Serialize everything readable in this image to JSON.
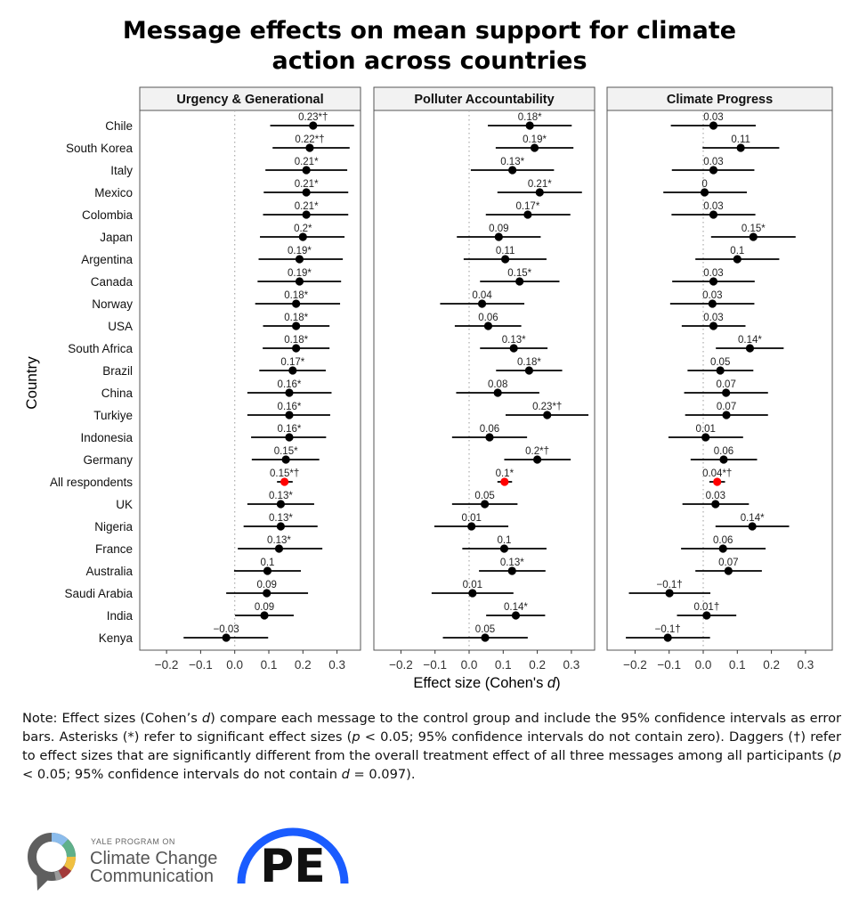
{
  "title_lines": [
    "Message effects on mean support for climate",
    "action across countries"
  ],
  "chart_data": {
    "type": "forest",
    "ylabel": "Country",
    "xlabel_main": "Effect size (Cohen's ",
    "xlabel_italic": "d",
    "xlabel_close": ")",
    "xlim": [
      -0.28,
      0.37
    ],
    "xticks": [
      -0.2,
      -0.1,
      0.0,
      0.1,
      0.2,
      0.3
    ],
    "xtick_labels": [
      "−0.2",
      "−0.1",
      "0.0",
      "0.1",
      "0.2",
      "0.3"
    ],
    "reference_line": 0,
    "highlight_color": "#ff0000",
    "point_color": "#000000",
    "countries": [
      "Chile",
      "South Korea",
      "Italy",
      "Mexico",
      "Colombia",
      "Japan",
      "Argentina",
      "Canada",
      "Norway",
      "USA",
      "South Africa",
      "Brazil",
      "China",
      "Turkiye",
      "Indonesia",
      "Germany",
      "All respondents",
      "UK",
      "Nigeria",
      "France",
      "Australia",
      "Saudi Arabia",
      "India",
      "Kenya"
    ],
    "highlight_row": "All respondents",
    "panels": [
      {
        "title": "Urgency & Generational",
        "points": [
          {
            "label": "0.23*†",
            "d": 0.23,
            "ci": [
              0.104,
              0.35
            ]
          },
          {
            "label": "0.22*†",
            "d": 0.22,
            "ci": [
              0.111,
              0.337
            ]
          },
          {
            "label": "0.21*",
            "d": 0.21,
            "ci": [
              0.09,
              0.33
            ]
          },
          {
            "label": "0.21*",
            "d": 0.21,
            "ci": [
              0.085,
              0.333
            ]
          },
          {
            "label": "0.21*",
            "d": 0.21,
            "ci": [
              0.083,
              0.333
            ]
          },
          {
            "label": "0.2*",
            "d": 0.2,
            "ci": [
              0.074,
              0.322
            ]
          },
          {
            "label": "0.19*",
            "d": 0.19,
            "ci": [
              0.07,
              0.317
            ]
          },
          {
            "label": "0.19*",
            "d": 0.19,
            "ci": [
              0.067,
              0.312
            ]
          },
          {
            "label": "0.18*",
            "d": 0.18,
            "ci": [
              0.06,
              0.309
            ]
          },
          {
            "label": "0.18*",
            "d": 0.18,
            "ci": [
              0.083,
              0.278
            ]
          },
          {
            "label": "0.18*",
            "d": 0.18,
            "ci": [
              0.082,
              0.278
            ]
          },
          {
            "label": "0.17*",
            "d": 0.17,
            "ci": [
              0.072,
              0.267
            ]
          },
          {
            "label": "0.16*",
            "d": 0.16,
            "ci": [
              0.037,
              0.284
            ]
          },
          {
            "label": "0.16*",
            "d": 0.16,
            "ci": [
              0.037,
              0.28
            ]
          },
          {
            "label": "0.16*",
            "d": 0.16,
            "ci": [
              0.048,
              0.268
            ]
          },
          {
            "label": "0.15*",
            "d": 0.15,
            "ci": [
              0.05,
              0.248
            ]
          },
          {
            "label": "0.15*†",
            "d": 0.146,
            "ci": [
              0.124,
              0.17
            ]
          },
          {
            "label": "0.13*",
            "d": 0.135,
            "ci": [
              0.037,
              0.233
            ]
          },
          {
            "label": "0.13*",
            "d": 0.135,
            "ci": [
              0.026,
              0.243
            ]
          },
          {
            "label": "0.13*",
            "d": 0.13,
            "ci": [
              0.009,
              0.257
            ]
          },
          {
            "label": "0.1",
            "d": 0.096,
            "ci": [
              -0.002,
              0.194
            ]
          },
          {
            "label": "0.09",
            "d": 0.094,
            "ci": [
              -0.025,
              0.215
            ]
          },
          {
            "label": "0.09",
            "d": 0.087,
            "ci": [
              0.001,
              0.173
            ]
          },
          {
            "label": "−0.03",
            "d": -0.025,
            "ci": [
              -0.15,
              0.098
            ]
          }
        ]
      },
      {
        "title": "Polluter Accountability",
        "points": [
          {
            "label": "0.18*",
            "d": 0.178,
            "ci": [
              0.055,
              0.301
            ]
          },
          {
            "label": "0.19*",
            "d": 0.192,
            "ci": [
              0.078,
              0.306
            ]
          },
          {
            "label": "0.13*",
            "d": 0.127,
            "ci": [
              0.005,
              0.249
            ]
          },
          {
            "label": "0.21*",
            "d": 0.207,
            "ci": [
              0.083,
              0.331
            ]
          },
          {
            "label": "0.17*",
            "d": 0.172,
            "ci": [
              0.049,
              0.297
            ]
          },
          {
            "label": "0.09",
            "d": 0.087,
            "ci": [
              -0.036,
              0.21
            ]
          },
          {
            "label": "0.11",
            "d": 0.106,
            "ci": [
              -0.016,
              0.227
            ]
          },
          {
            "label": "0.15*",
            "d": 0.148,
            "ci": [
              0.032,
              0.265
            ]
          },
          {
            "label": "0.04",
            "d": 0.038,
            "ci": [
              -0.085,
              0.162
            ]
          },
          {
            "label": "0.06",
            "d": 0.056,
            "ci": [
              -0.042,
              0.153
            ]
          },
          {
            "label": "0.13*",
            "d": 0.131,
            "ci": [
              0.032,
              0.23
            ]
          },
          {
            "label": "0.18*",
            "d": 0.176,
            "ci": [
              0.079,
              0.273
            ]
          },
          {
            "label": "0.08",
            "d": 0.084,
            "ci": [
              -0.038,
              0.206
            ]
          },
          {
            "label": "0.23*†",
            "d": 0.229,
            "ci": [
              0.107,
              0.35
            ]
          },
          {
            "label": "0.06",
            "d": 0.06,
            "ci": [
              -0.05,
              0.17
            ]
          },
          {
            "label": "0.2*†",
            "d": 0.2,
            "ci": [
              0.103,
              0.298
            ]
          },
          {
            "label": "0.1*",
            "d": 0.104,
            "ci": [
              0.083,
              0.126
            ]
          },
          {
            "label": "0.05",
            "d": 0.046,
            "ci": [
              -0.05,
              0.142
            ]
          },
          {
            "label": "0.01",
            "d": 0.007,
            "ci": [
              -0.102,
              0.115
            ]
          },
          {
            "label": "0.1",
            "d": 0.103,
            "ci": [
              -0.02,
              0.227
            ]
          },
          {
            "label": "0.13*",
            "d": 0.126,
            "ci": [
              0.029,
              0.224
            ]
          },
          {
            "label": "0.01",
            "d": 0.01,
            "ci": [
              -0.11,
              0.13
            ]
          },
          {
            "label": "0.14*",
            "d": 0.137,
            "ci": [
              0.05,
              0.223
            ]
          },
          {
            "label": "0.05",
            "d": 0.047,
            "ci": [
              -0.077,
              0.172
            ]
          }
        ]
      },
      {
        "title": "Climate Progress",
        "points": [
          {
            "label": "0.03",
            "d": 0.03,
            "ci": [
              -0.095,
              0.154
            ]
          },
          {
            "label": "0.11",
            "d": 0.11,
            "ci": [
              -0.002,
              0.223
            ]
          },
          {
            "label": "0.03",
            "d": 0.03,
            "ci": [
              -0.092,
              0.15
            ]
          },
          {
            "label": "0",
            "d": 0.004,
            "ci": [
              -0.117,
              0.128
            ]
          },
          {
            "label": "0.03",
            "d": 0.03,
            "ci": [
              -0.093,
              0.153
            ]
          },
          {
            "label": "0.15*",
            "d": 0.147,
            "ci": [
              0.023,
              0.271
            ]
          },
          {
            "label": "0.1",
            "d": 0.1,
            "ci": [
              -0.023,
              0.223
            ]
          },
          {
            "label": "0.03",
            "d": 0.03,
            "ci": [
              -0.091,
              0.151
            ]
          },
          {
            "label": "0.03",
            "d": 0.027,
            "ci": [
              -0.097,
              0.15
            ]
          },
          {
            "label": "0.03",
            "d": 0.03,
            "ci": [
              -0.063,
              0.124
            ]
          },
          {
            "label": "0.14*",
            "d": 0.137,
            "ci": [
              0.037,
              0.236
            ]
          },
          {
            "label": "0.05",
            "d": 0.05,
            "ci": [
              -0.046,
              0.147
            ]
          },
          {
            "label": "0.07",
            "d": 0.067,
            "ci": [
              -0.056,
              0.19
            ]
          },
          {
            "label": "0.07",
            "d": 0.068,
            "ci": [
              -0.053,
              0.19
            ]
          },
          {
            "label": "0.01",
            "d": 0.007,
            "ci": [
              -0.102,
              0.117
            ]
          },
          {
            "label": "0.06",
            "d": 0.06,
            "ci": [
              -0.037,
              0.158
            ]
          },
          {
            "label": "0.04*†",
            "d": 0.041,
            "ci": [
              0.018,
              0.064
            ]
          },
          {
            "label": "0.03",
            "d": 0.036,
            "ci": [
              -0.061,
              0.134
            ]
          },
          {
            "label": "0.14*",
            "d": 0.144,
            "ci": [
              0.036,
              0.252
            ]
          },
          {
            "label": "0.06",
            "d": 0.058,
            "ci": [
              -0.065,
              0.183
            ]
          },
          {
            "label": "0.07",
            "d": 0.074,
            "ci": [
              -0.023,
              0.172
            ]
          },
          {
            "label": "−0.1†",
            "d": -0.099,
            "ci": [
              -0.218,
              0.021
            ]
          },
          {
            "label": "0.01†",
            "d": 0.01,
            "ci": [
              -0.077,
              0.097
            ]
          },
          {
            "label": "−0.1†",
            "d": -0.104,
            "ci": [
              -0.227,
              0.02
            ]
          }
        ]
      }
    ]
  },
  "note_parts": [
    {
      "t": "Note: Effect sizes (Cohen’s "
    },
    {
      "t": "d",
      "i": true
    },
    {
      "t": ") compare each message to the control group and include the 95% confidence intervals as error bars. Asterisks (*) refer to significant effect sizes ("
    },
    {
      "t": "p",
      "i": true
    },
    {
      "t": " < 0.05; 95% confidence intervals do not contain zero). Daggers (†) refer to effect sizes that are significantly different from the overall treatment effect of all three messages among all participants ("
    },
    {
      "t": "p",
      "i": true
    },
    {
      "t": " < 0.05; 95% confidence intervals do not contain "
    },
    {
      "t": "d",
      "i": true
    },
    {
      "t": " = 0.097)."
    }
  ],
  "logos": {
    "yale": {
      "line1": "YALE PROGRAM ON",
      "line2": "Climate Change",
      "line3": "Communication",
      "colors": [
        "#5f5f5f",
        "#8bbcec",
        "#5fb08a",
        "#f0c040",
        "#a33a3a",
        "#9a9a9a"
      ]
    },
    "pe": {
      "text": "PE",
      "arc_color": "#1a5cff"
    }
  }
}
